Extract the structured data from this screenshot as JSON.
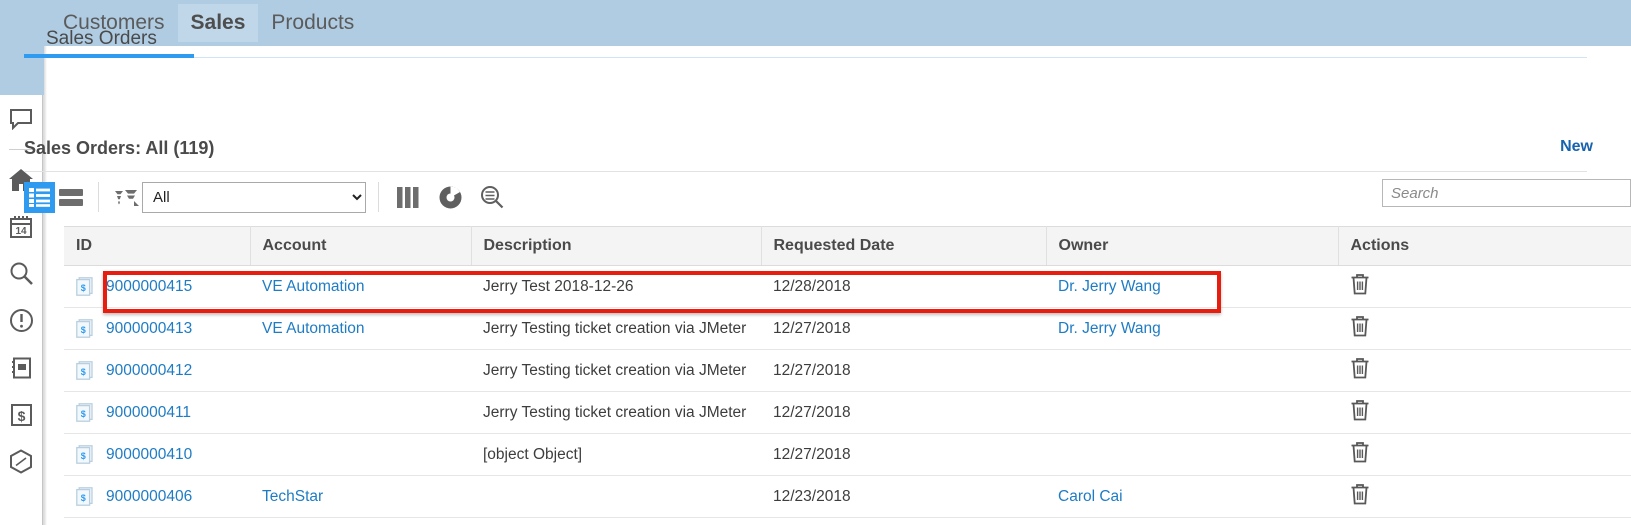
{
  "header": {
    "nav": [
      {
        "label": "Customers",
        "active": false
      },
      {
        "label": "Sales",
        "active": true
      },
      {
        "label": "Products",
        "active": false
      }
    ]
  },
  "sidebar": {
    "items": [
      {
        "name": "chat-icon"
      },
      {
        "name": "home-icon"
      },
      {
        "name": "calendar-icon",
        "day": "14"
      },
      {
        "name": "search-icon"
      },
      {
        "name": "alert-icon"
      },
      {
        "name": "notebook-icon"
      },
      {
        "name": "invoice-icon"
      },
      {
        "name": "package-icon"
      }
    ]
  },
  "main": {
    "subtab": "Sales Orders",
    "title": "Sales Orders: All (119)",
    "new_label": "New",
    "toolbar": {
      "list_view": "list-view-icon",
      "card_view": "card-view-icon",
      "sort_icon": "sort-icon",
      "filter_value": "All",
      "filter_options": [
        "All"
      ],
      "columns_icon": "columns-chart-icon",
      "pie_icon": "pie-chart-icon",
      "advanced_search_icon": "advanced-search-icon"
    },
    "search": {
      "placeholder": "Search",
      "value": ""
    },
    "table": {
      "columns": [
        "ID",
        "Account",
        "Description",
        "Requested Date",
        "Owner",
        "Actions"
      ],
      "rows": [
        {
          "id": "9000000415",
          "account": "VE Automation",
          "description": "Jerry Test 2018-12-26",
          "requested_date": "12/28/2018",
          "owner": "Dr. Jerry Wang",
          "action": "delete-icon",
          "highlighted": true
        },
        {
          "id": "9000000413",
          "account": "VE Automation",
          "description": "Jerry Testing ticket creation via JMeter",
          "requested_date": "12/27/2018",
          "owner": "Dr. Jerry Wang",
          "action": "delete-icon",
          "highlighted": false
        },
        {
          "id": "9000000412",
          "account": "",
          "description": "Jerry Testing ticket creation via JMeter",
          "requested_date": "12/27/2018",
          "owner": "",
          "action": "delete-icon",
          "highlighted": false
        },
        {
          "id": "9000000411",
          "account": "",
          "description": "Jerry Testing ticket creation via JMeter",
          "requested_date": "12/27/2018",
          "owner": "",
          "action": "delete-icon",
          "highlighted": false
        },
        {
          "id": "9000000410",
          "account": "",
          "description": "[object Object]",
          "requested_date": "12/27/2018",
          "owner": "",
          "action": "delete-icon",
          "highlighted": false
        },
        {
          "id": "9000000406",
          "account": "TechStar",
          "description": "",
          "requested_date": "12/23/2018",
          "owner": "Carol Cai",
          "action": "delete-icon",
          "highlighted": false
        }
      ]
    }
  },
  "colors": {
    "header_blue": "#afcce2",
    "active_tab_blue": "#c0d7e9",
    "accent_blue": "#2e9bf0",
    "link_blue": "#1e7cc4",
    "new_link": "#1763ad",
    "highlight_red": "#e71d0f"
  }
}
